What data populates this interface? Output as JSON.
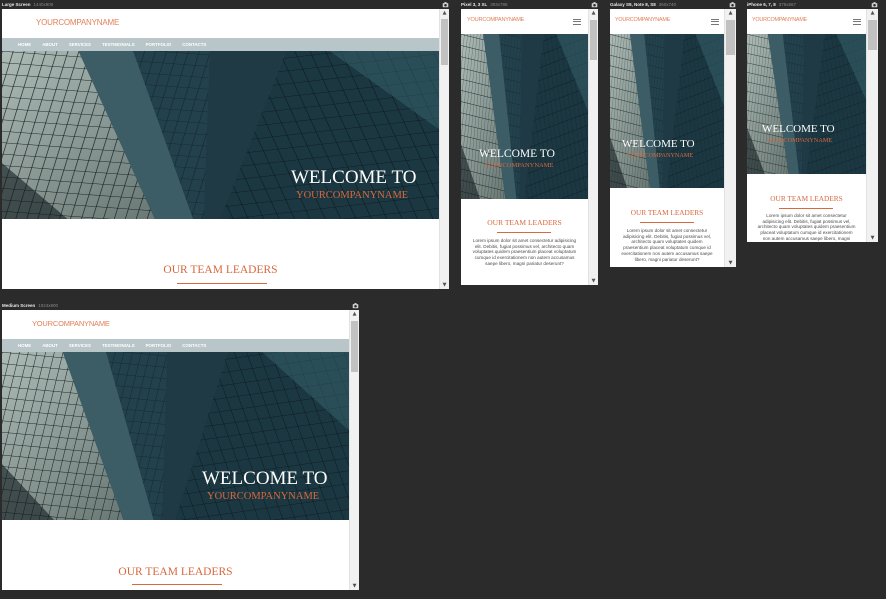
{
  "brand": {
    "company": "YOURCOMPANYNAME",
    "accent": "#d8683e",
    "nav_bg": "#b9c6c9"
  },
  "nav": [
    "HOME",
    "ABOUT",
    "SERVICES",
    "TESTIMONIALS",
    "PORTFOLIO",
    "CONTACTS"
  ],
  "hero": {
    "welcome": "WELCOME TO",
    "company": "YOURCOMPANYNAME"
  },
  "section": {
    "title": "OUR TEAM LEADERS",
    "text": "Lorem ipsum dolor sit amet consectetur adipisicing elit. Debitis, fugiat possimus vel, architecto quam voluptates quidem praesentium placeat voluptatum cumque id exercitationem non autem accusamus saepe libero, magni pariatur deserunt?"
  },
  "devices": {
    "large": {
      "name": "Large Screen",
      "dims": "1440x900"
    },
    "medium": {
      "name": "Medium Screen",
      "dims": "1024x800"
    },
    "pixel": {
      "name": "Pixel 3, 3 XL",
      "dims": "393x786"
    },
    "galaxy": {
      "name": "Galaxy S9, Note 8, S8",
      "dims": "360x740"
    },
    "iphone": {
      "name": "iPhone 6, 7, 8",
      "dims": "375x667"
    }
  },
  "icons": {
    "camera": "camera-icon",
    "menu": "hamburger-menu-icon",
    "scroll_up": "scroll-up-arrow-icon",
    "scroll_down": "scroll-down-arrow-icon"
  }
}
